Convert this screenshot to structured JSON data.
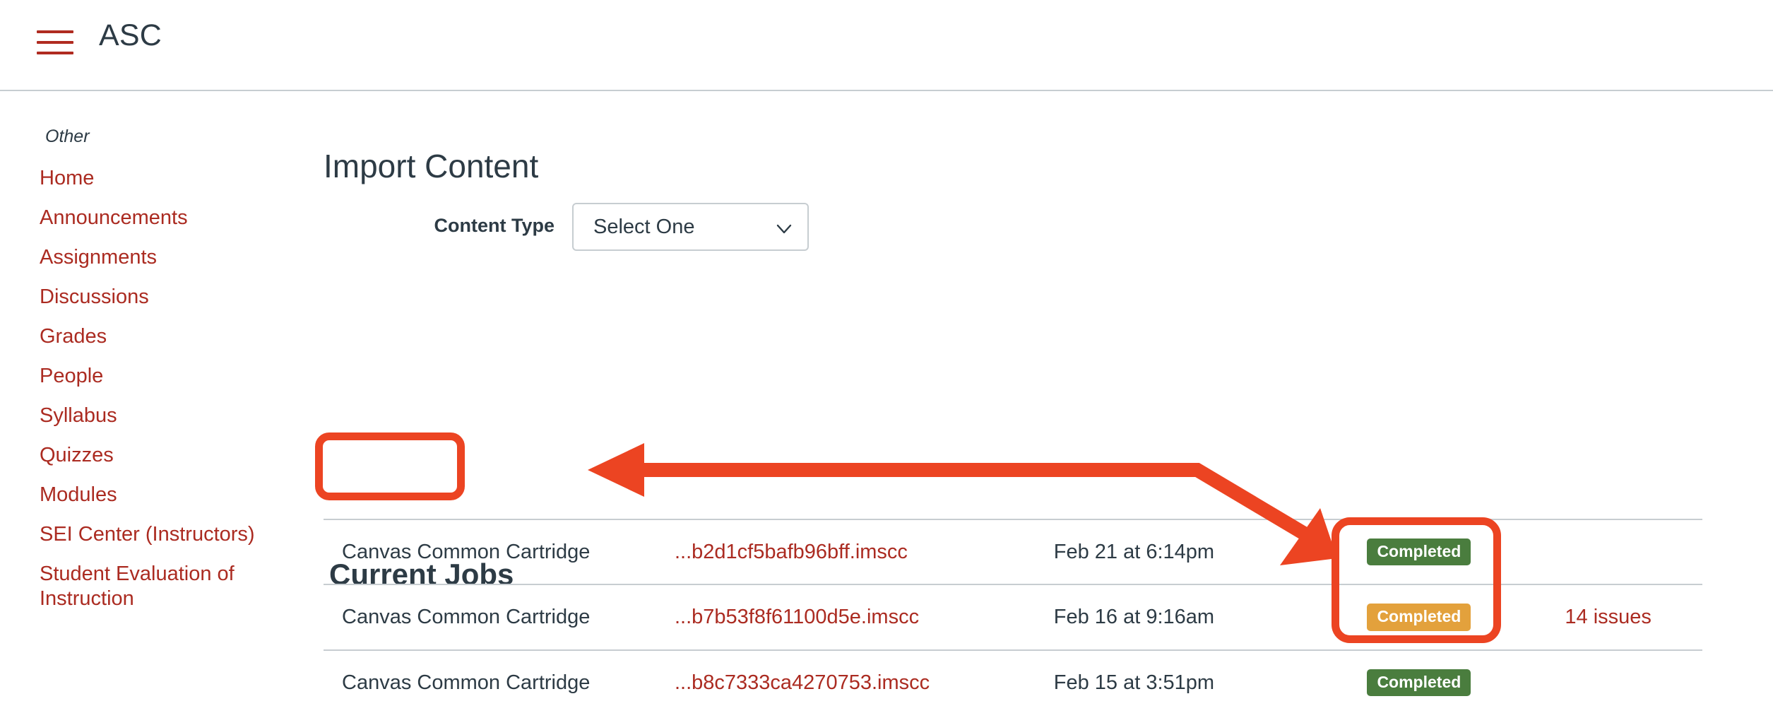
{
  "header": {
    "menu_icon": "hamburger-menu-icon",
    "course_title": "ASC"
  },
  "sidebar": {
    "section_label": "Other",
    "items": [
      {
        "label": "Home"
      },
      {
        "label": "Announcements"
      },
      {
        "label": "Assignments"
      },
      {
        "label": "Discussions"
      },
      {
        "label": "Grades"
      },
      {
        "label": "People"
      },
      {
        "label": "Syllabus"
      },
      {
        "label": "Quizzes"
      },
      {
        "label": "Modules"
      },
      {
        "label": "SEI Center (Instructors)"
      },
      {
        "label": "Student Evaluation of Instruction"
      }
    ]
  },
  "main": {
    "page_title": "Import Content",
    "content_type": {
      "label": "Content Type",
      "selected": "Select One",
      "chevron_icon": "chevron-down-icon"
    },
    "current_jobs": {
      "heading": "Current Jobs",
      "rows": [
        {
          "type": "Canvas Common Cartridge",
          "file": "...b2d1cf5bafb96bff.imscc",
          "date": "Feb 21 at 6:14pm",
          "status": "Completed",
          "status_kind": "completed",
          "issues": ""
        },
        {
          "type": "Canvas Common Cartridge",
          "file": "...b7b53f8f61100d5e.imscc",
          "date": "Feb 16 at 9:16am",
          "status": "Completed",
          "status_kind": "warning",
          "issues": "14 issues"
        },
        {
          "type": "Canvas Common Cartridge",
          "file": "...b8c7333ca4270753.imscc",
          "date": "Feb 15 at 3:51pm",
          "status": "Completed",
          "status_kind": "completed",
          "issues": ""
        }
      ]
    }
  },
  "annotations": {
    "color": "#ec4422",
    "highlight_boxes": [
      "Current Jobs",
      "status badges column"
    ],
    "arrow": "double-headed arrow from status badges to Current Jobs heading"
  },
  "colors": {
    "link_red": "#ab2b21",
    "brand_red": "#b02b20",
    "annotation_red": "#ec4422",
    "badge_green": "#4a7d3e",
    "badge_orange": "#e3a13c",
    "border_gray": "#c7cdd1",
    "text": "#2d3b45"
  }
}
